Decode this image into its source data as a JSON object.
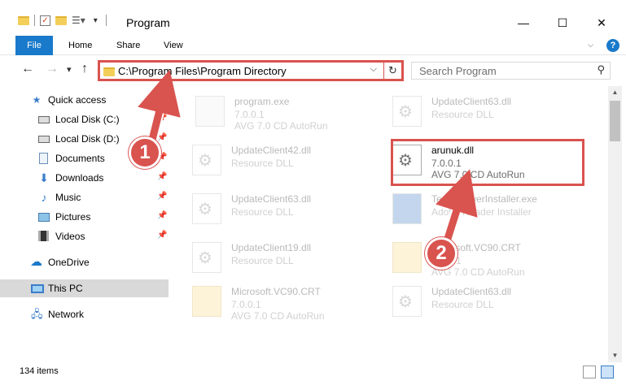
{
  "window": {
    "title": "Program",
    "minimize": "—",
    "maximize": "☐",
    "close": "✕"
  },
  "ribbon": {
    "tabs": [
      "File",
      "Home",
      "Share",
      "View"
    ],
    "help": "?"
  },
  "nav": {
    "back": "←",
    "forward": "→",
    "recent": "▾",
    "up": "↑",
    "address": "C:\\Program Files\\Program Directory",
    "address_dropdown": "⌵",
    "refresh": "↻",
    "search_placeholder": "Search Program",
    "search_icon": "⚲"
  },
  "sidebar": {
    "items": [
      {
        "label": "Quick access",
        "icon": "star-icon",
        "pinned": false
      },
      {
        "label": "Local Disk (C:)",
        "icon": "drive-icon",
        "pinned": true
      },
      {
        "label": "Local Disk (D:)",
        "icon": "drive-icon",
        "pinned": true
      },
      {
        "label": "Documents",
        "icon": "document-icon",
        "pinned": true
      },
      {
        "label": "Downloads",
        "icon": "download-icon",
        "pinned": true
      },
      {
        "label": "Music",
        "icon": "music-icon",
        "pinned": true
      },
      {
        "label": "Pictures",
        "icon": "pictures-icon",
        "pinned": true
      },
      {
        "label": "Videos",
        "icon": "videos-icon",
        "pinned": true
      },
      {
        "label": "OneDrive",
        "icon": "cloud-icon",
        "pinned": false
      },
      {
        "label": "This PC",
        "icon": "computer-icon",
        "pinned": false,
        "selected": true
      },
      {
        "label": "Network",
        "icon": "network-icon",
        "pinned": false
      }
    ]
  },
  "files": [
    {
      "name": "program.exe",
      "line2": "7.0.0.1",
      "line3": "AVG 7.0 CD AutoRun",
      "type": "exe",
      "faded": true
    },
    {
      "name": "UpdateClient63.dll",
      "line2": "Resource DLL",
      "line3": "",
      "type": "dll",
      "faded": true
    },
    {
      "name": "UpdateClient42.dll",
      "line2": "Resource DLL",
      "line3": "",
      "type": "dll",
      "faded": true
    },
    {
      "name": "arunuk.dll",
      "line2": "7.0.0.1",
      "line3": "AVG 7.0 CD AutoRun",
      "type": "dll",
      "faded": false
    },
    {
      "name": "UpdateClient63.dll",
      "line2": "Resource DLL",
      "line3": "",
      "type": "dll",
      "faded": true
    },
    {
      "name": "TeamViewerInstaller.exe",
      "line2": "Adobe Reader Installer",
      "line3": "",
      "type": "exe",
      "faded": true
    },
    {
      "name": "UpdateClient19.dll",
      "line2": "Resource DLL",
      "line3": "",
      "type": "dll",
      "faded": true
    },
    {
      "name": "Microsoft.VC90.CRT",
      "line2": "7.0.0.1",
      "line3": "AVG 7.0 CD AutoRun",
      "type": "crt",
      "faded": true
    },
    {
      "name": "Microsoft.VC90.CRT",
      "line2": "7.0.0.1",
      "line3": "AVG 7.0 CD AutoRun",
      "type": "crt",
      "faded": true
    },
    {
      "name": "UpdateClient63.dll",
      "line2": "Resource DLL",
      "line3": "",
      "type": "dll",
      "faded": true
    }
  ],
  "status": {
    "item_count": "134 items"
  },
  "callouts": [
    "1",
    "2"
  ],
  "colors": {
    "accent": "#1979ca",
    "highlight": "#d9534f"
  }
}
